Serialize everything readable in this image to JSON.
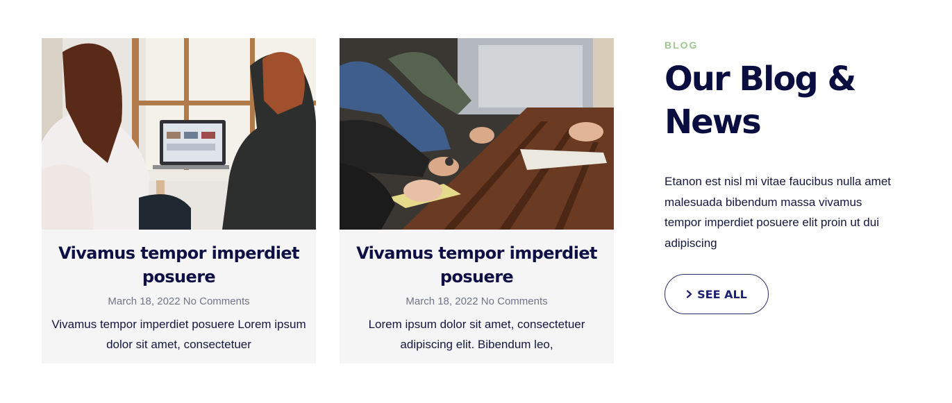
{
  "posts": [
    {
      "title": "Vivamus tempor imperdiet posuere",
      "date": "March 18, 2022",
      "comments": "No Comments",
      "excerpt": "Vivamus tempor imperdiet posuere Lorem ipsum dolor sit amet, consectetuer"
    },
    {
      "title": "Vivamus tempor imperdiet posuere",
      "date": "March 18, 2022",
      "comments": "No Comments",
      "excerpt": "Lorem ipsum dolor sit amet, consectetuer adipiscing elit. Bibendum leo,"
    }
  ],
  "section": {
    "label": "BLOG",
    "title": "Our Blog & News",
    "description": "Etanon est nisl mi vitae faucibus nulla amet malesuada bibendum massa vivamus tempor imperdiet posuere elit proin ut dui adipiscing",
    "button_label": "SEE ALL",
    "button_icon": "chevron-right-icon"
  },
  "colors": {
    "heading": "#0a0d3f",
    "label_accent": "#9dc78f",
    "button_text": "#1e2070",
    "card_bg": "#f5f5f5"
  }
}
